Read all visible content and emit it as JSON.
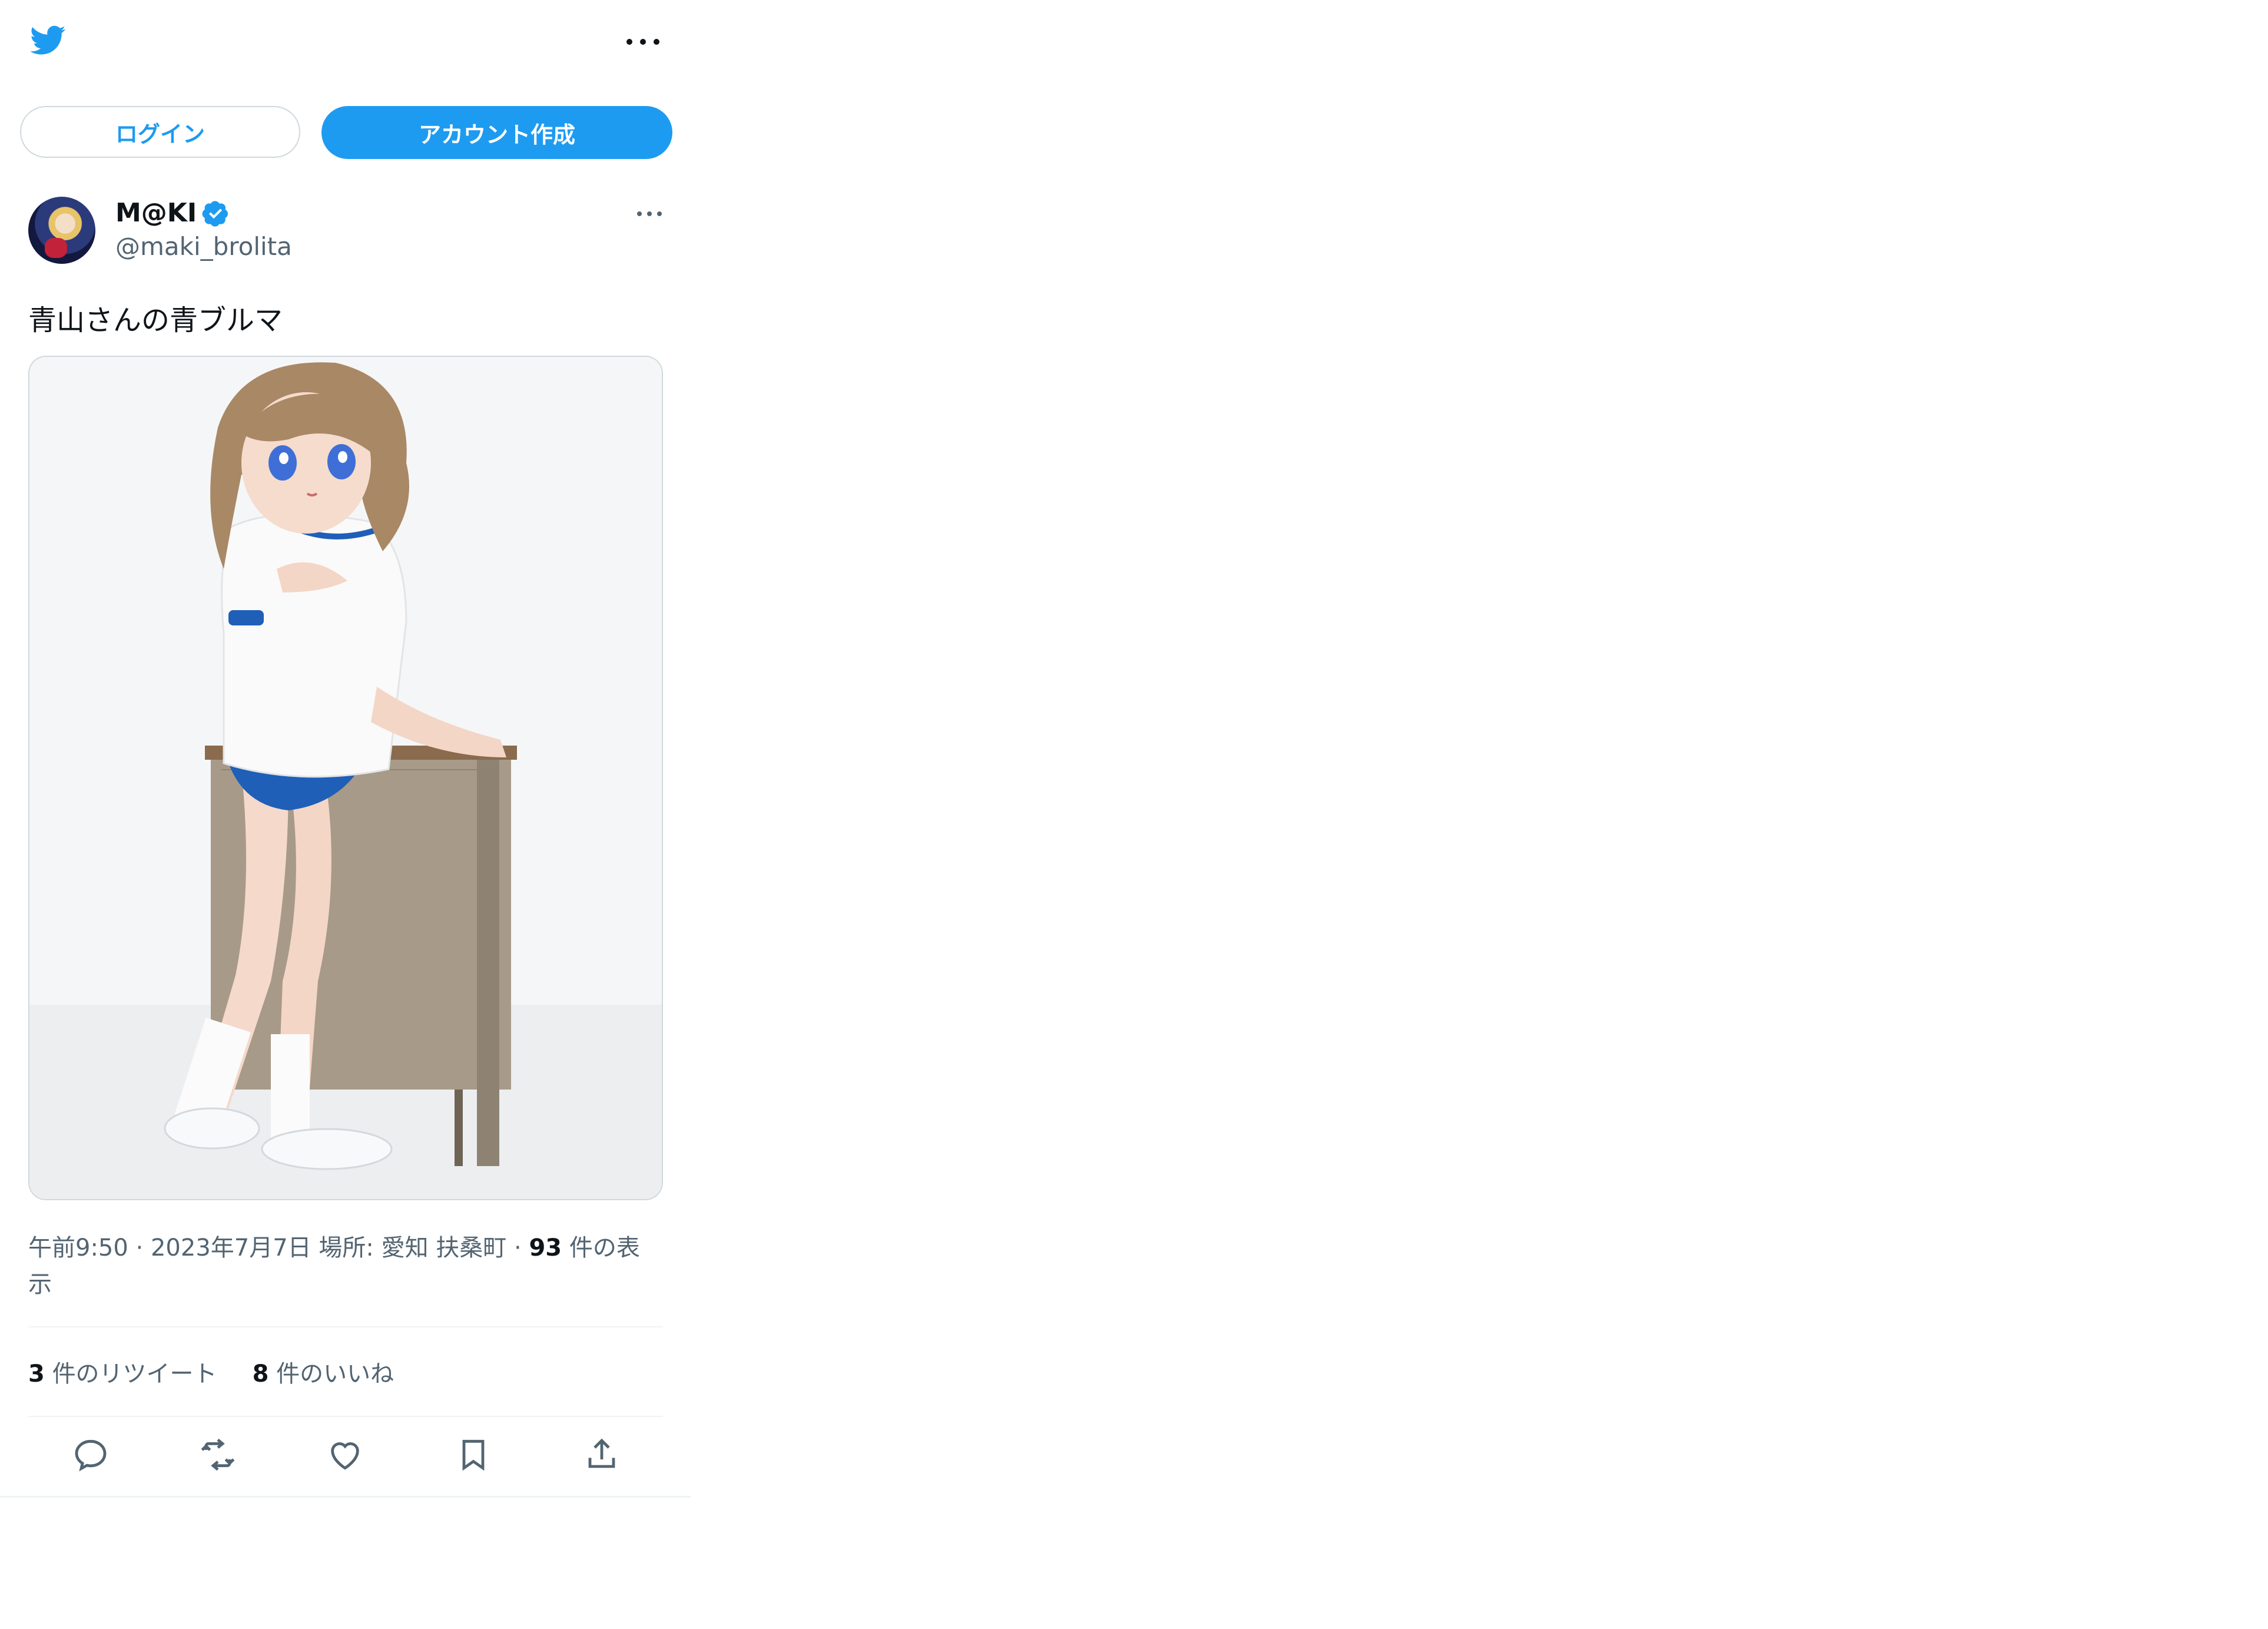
{
  "header": {
    "logo_icon": "twitter-bird-icon",
    "more_icon": "more-horizontal-icon"
  },
  "auth": {
    "login_label": "ログイン",
    "signup_label": "アカウント作成"
  },
  "tweet": {
    "author": {
      "display_name": "M@KI",
      "verified": true,
      "handle": "@maki_brolita"
    },
    "text": "青山さんの青ブルマ",
    "meta": {
      "time": "午前9:50",
      "date": "2023年7月7日",
      "location_label": "場所: 愛知 扶桑町",
      "views_count": "93",
      "views_label": "件の表示"
    },
    "stats": {
      "retweets_count": "3",
      "retweets_label": "件のリツイート",
      "likes_count": "8",
      "likes_label": "件のいいね"
    },
    "actions": [
      {
        "icon": "reply-icon"
      },
      {
        "icon": "retweet-icon"
      },
      {
        "icon": "like-icon"
      },
      {
        "icon": "bookmark-icon"
      },
      {
        "icon": "share-icon"
      }
    ]
  },
  "colors": {
    "brand": "#1d9bf0",
    "text_primary": "#0f1419",
    "text_secondary": "#536471",
    "border": "#cfd9de"
  }
}
